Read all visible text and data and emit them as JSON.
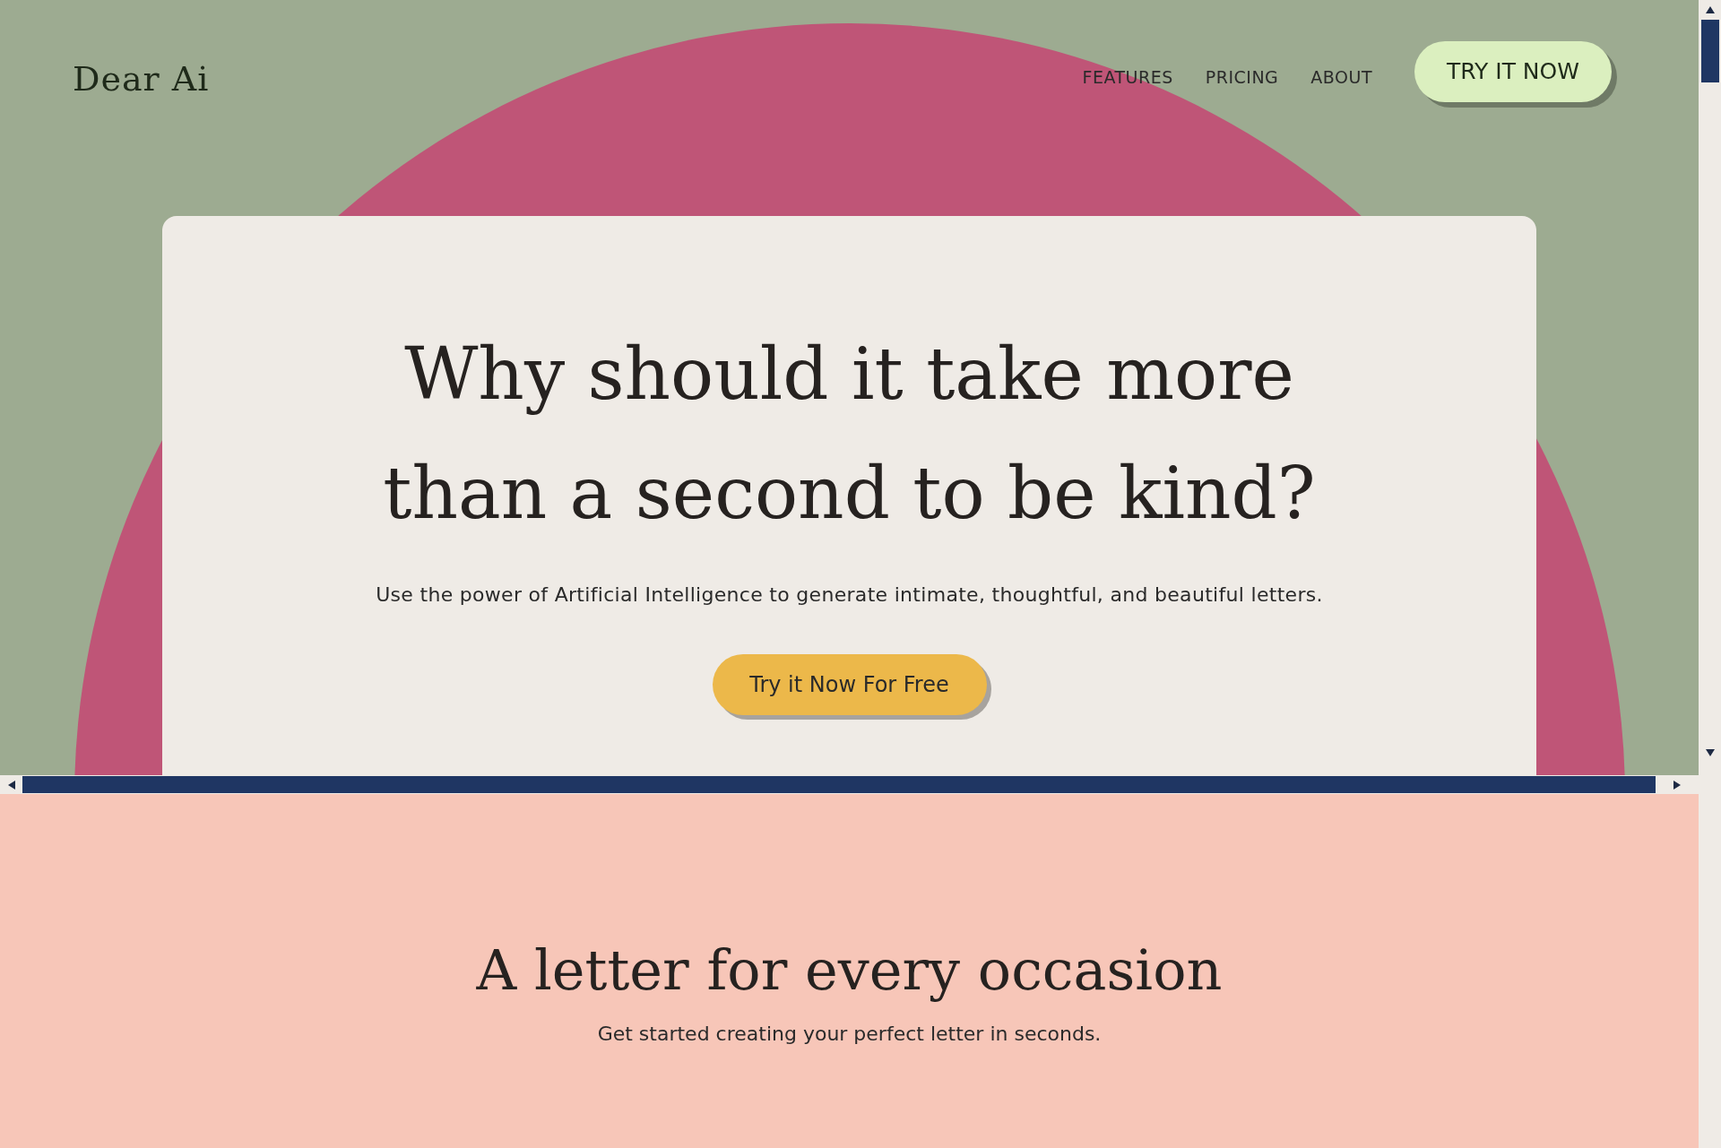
{
  "header": {
    "logo": "Dear Ai",
    "nav_links": [
      "FEATURES",
      "PRICING",
      "ABOUT"
    ],
    "cta": "TRY IT NOW"
  },
  "hero": {
    "title_lines": [
      "Why should it take more",
      "than a second to be kind?"
    ],
    "subtitle": "Use the power of Artificial Intelligence to generate intimate, thoughtful, and beautiful letters.",
    "button": "Try it Now For Free"
  },
  "occasions": {
    "title": "A letter for every occasion",
    "subtitle": "Get started creating your perfect letter in seconds."
  }
}
